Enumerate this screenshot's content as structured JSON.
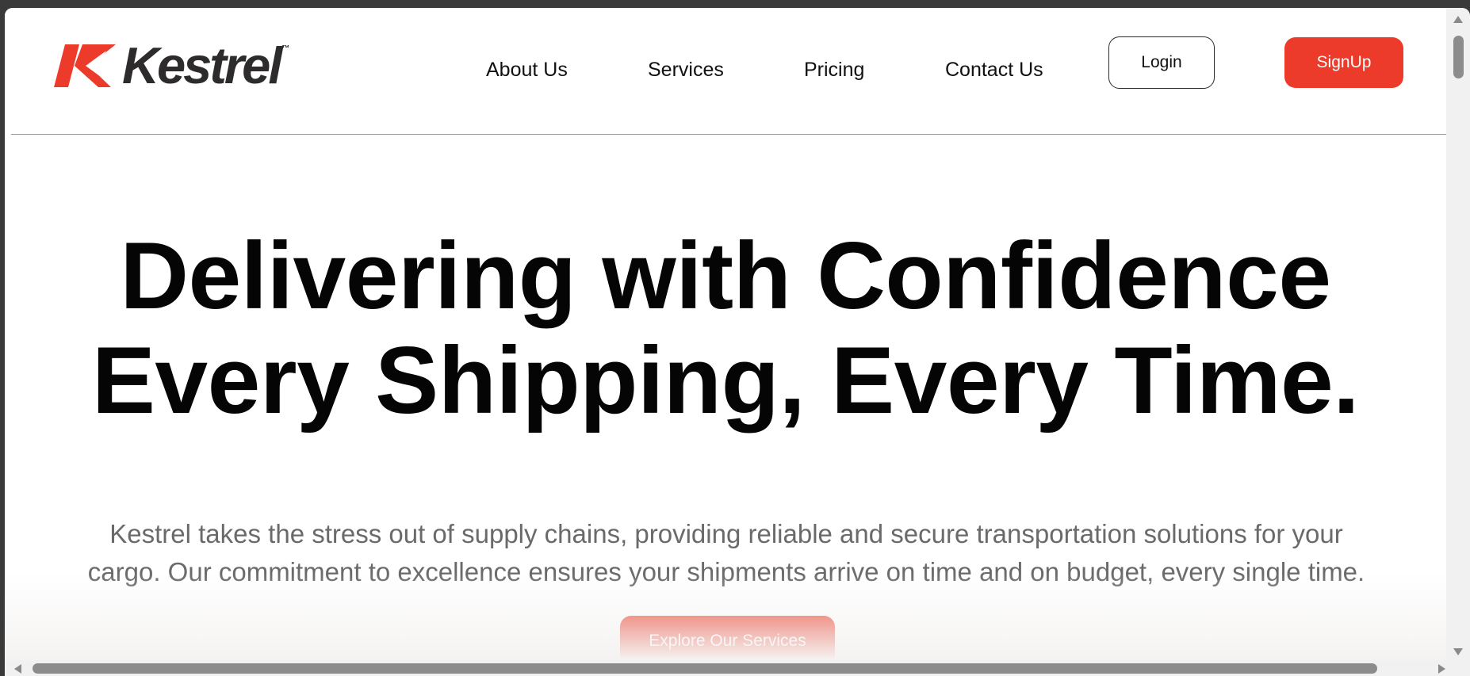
{
  "brand": {
    "name": "Kestrel",
    "tm": "™",
    "accent_color": "#ec3b2a",
    "text_color": "#2e2b2c"
  },
  "nav": {
    "items": [
      {
        "label": "About Us"
      },
      {
        "label": "Services"
      },
      {
        "label": "Pricing"
      },
      {
        "label": "Contact Us"
      }
    ],
    "login_label": "Login",
    "signup_label": "SignUp"
  },
  "hero": {
    "title_line1": "Delivering with Confidence",
    "title_line2": "Every Shipping, Every Time.",
    "subtitle_line1": "Kestrel takes the stress out of supply chains, providing reliable and secure transportation solutions for your",
    "subtitle_line2": "cargo. Our commitment to excellence ensures your shipments arrive on time and on budget, every single time.",
    "cta_label": "Explore Our Services"
  }
}
